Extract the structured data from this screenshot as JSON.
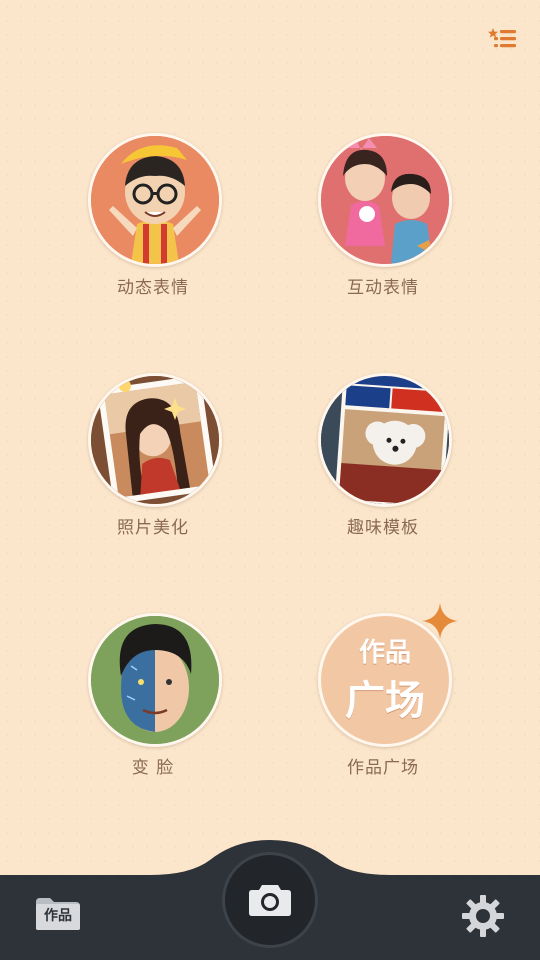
{
  "header": {
    "menu_icon": "star-list-icon"
  },
  "features": [
    {
      "label": "动态表情",
      "icon": "cartoon-boy-avatar-icon",
      "ring_color": "#e07a55"
    },
    {
      "label": "互动表情",
      "icon": "couple-cartoon-avatar-icon",
      "ring_color": "#de6a6a"
    },
    {
      "label": "照片美化",
      "icon": "photo-beauty-icon",
      "ring_color": "#8b5a3c"
    },
    {
      "label": "趣味模板",
      "icon": "magazine-dog-icon",
      "ring_color": "#3a4a5a"
    },
    {
      "label": "变 脸",
      "icon": "face-change-icon",
      "ring_color": "#7aa05a"
    },
    {
      "label": "作品广场",
      "icon": "works-square-icon",
      "ring_color": "#f2c7a4",
      "badge_line1": "作品",
      "badge_line2": "广场"
    }
  ],
  "bottom_bar": {
    "works_label": "作品",
    "camera_icon": "camera-icon",
    "settings_icon": "gear-icon"
  },
  "colors": {
    "background": "#fbe6cc",
    "label": "#8a6a53",
    "bar": "#2e3339",
    "accent": "#e07a30"
  }
}
